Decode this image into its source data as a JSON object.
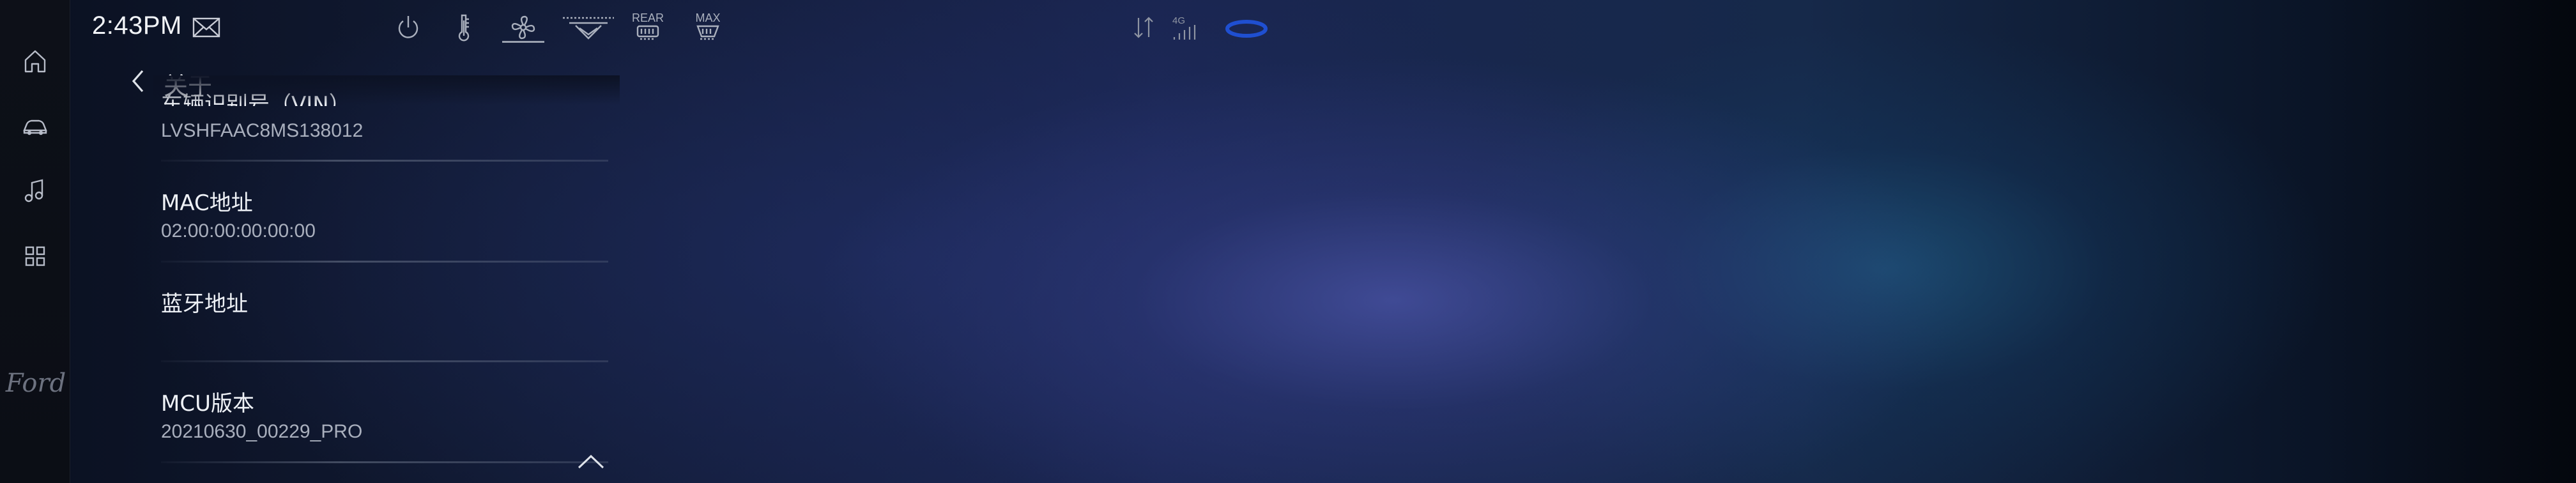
{
  "status_bar": {
    "time": "2:43PM",
    "climate": {
      "rear_label": "REAR",
      "max_label": "MAX"
    },
    "signal_label": "4G"
  },
  "header": {
    "title": "关于"
  },
  "about_list": [
    {
      "title": "车辆识别号（VIN）",
      "value": "LVSHFAAC8MS138012"
    },
    {
      "title": "MAC地址",
      "value": "02:00:00:00:00:00"
    },
    {
      "title": "蓝牙地址",
      "value": ""
    },
    {
      "title": "MCU版本",
      "value": "20210630_00229_PRO"
    }
  ],
  "dock": {
    "brand": "Ford"
  },
  "colors": {
    "accent_ring": "#1f4fd1",
    "text_primary": "#eef1f6",
    "text_secondary": "#a9afbd"
  }
}
